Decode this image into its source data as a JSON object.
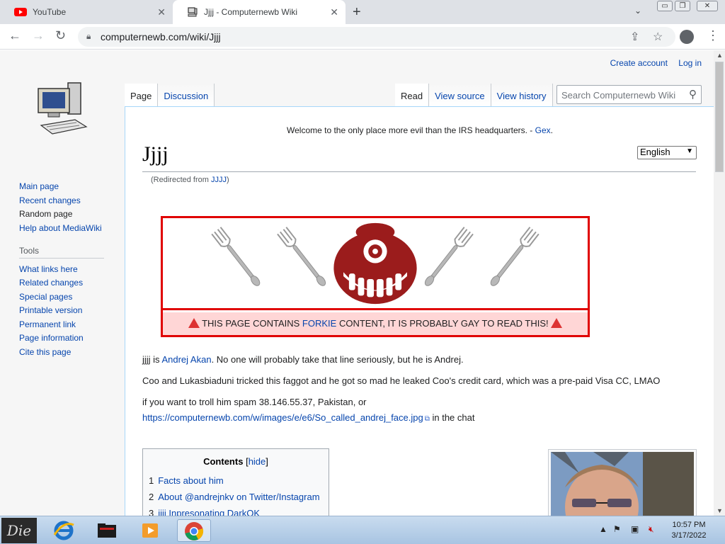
{
  "browser": {
    "tabs": [
      {
        "title": "YouTube",
        "icon": "youtube-icon"
      },
      {
        "title": "Jjjj - Computernewb Wiki",
        "icon": "wiki-favicon-icon"
      }
    ],
    "url": "computernewb.com/wiki/Jjjj"
  },
  "wiki": {
    "user_links": {
      "create_account": "Create account",
      "login": "Log in"
    },
    "sidebar": {
      "nav": [
        "Main page",
        "Recent changes",
        "Random page",
        "Help about MediaWiki"
      ],
      "tools_heading": "Tools",
      "tools": [
        "What links here",
        "Related changes",
        "Special pages",
        "Printable version",
        "Permanent link",
        "Page information",
        "Cite this page"
      ]
    },
    "tabs": {
      "page": "Page",
      "discussion": "Discussion",
      "read": "Read",
      "view_source": "View source",
      "view_history": "View history"
    },
    "search_placeholder": "Search Computernewb Wiki",
    "sitenotice": {
      "text": "Welcome to the only place more evil than the IRS headquarters. - ",
      "link": "Gex",
      "end": "."
    },
    "title": "Jjjj",
    "language": "English",
    "redirect": {
      "prefix": "(Redirected from ",
      "link": "JJJJ",
      "suffix": ")"
    },
    "banner": {
      "pre": " THIS PAGE CONTAINS ",
      "link": "FORKIE",
      "post": " CONTENT, IT IS PROBABLY GAY TO READ THIS! "
    },
    "paragraphs": {
      "p1_pre": "jjjj is ",
      "p1_link": "Andrej Akan",
      "p1_post": ". No one will probably take that line seriously, but he is Andrej.",
      "p2": "Coo and Lukasbiaduni tricked this faggot and he got so mad he leaked Coo's credit card, which was a pre-paid Visa CC, LMAO",
      "p3_pre": "if you want to troll him spam 38.146.55.37, Pakistan, or",
      "p3_link": "https://computernewb.com/w/images/e/e6/So_called_andrej_face.jpg",
      "p3_post": " in the chat"
    },
    "toc": {
      "title": "Contents",
      "hide_open": "[",
      "hide": "hide",
      "hide_close": "]",
      "items": [
        {
          "num": "1",
          "label": "Facts about him"
        },
        {
          "num": "2",
          "label": "About @andrejnkv on Twitter/Instagram"
        },
        {
          "num": "3",
          "label": "jjjj Inpresonating DarkOK"
        }
      ]
    }
  },
  "taskbar": {
    "time": "10:57 PM",
    "date": "3/17/2022"
  },
  "colors": {
    "link": "#0645ad",
    "banner_border": "#e00000",
    "banner_bg": "#ffd6d6",
    "fork_art": "#9b1c1c"
  }
}
